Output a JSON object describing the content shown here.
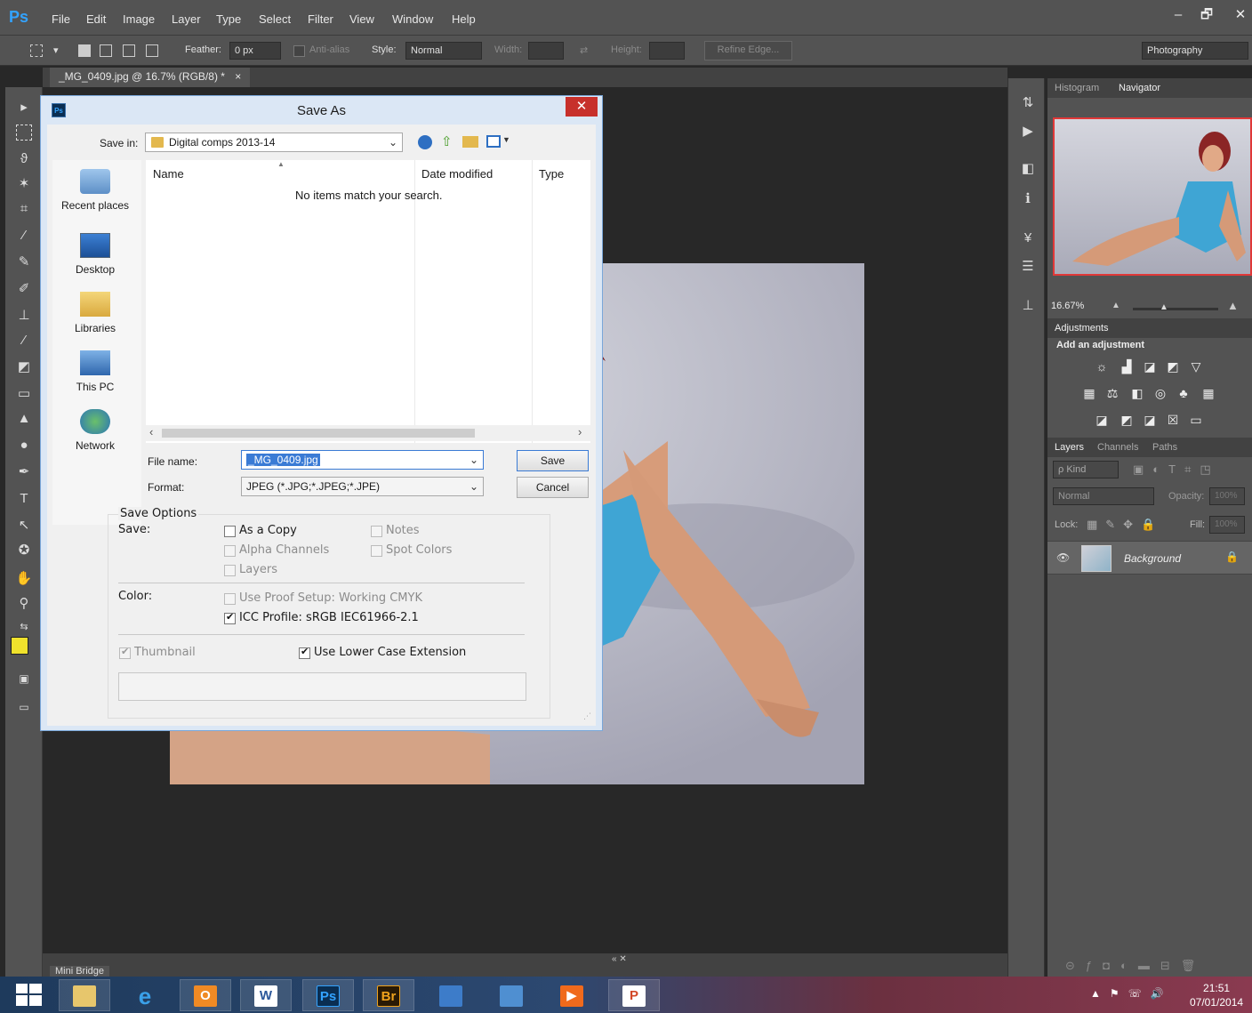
{
  "menubar": {
    "logo": "Ps",
    "items": [
      "File",
      "Edit",
      "Image",
      "Layer",
      "Type",
      "Select",
      "Filter",
      "View",
      "Window",
      "Help"
    ],
    "controls": {
      "minimize": "–",
      "restore": "🗗",
      "close": "✕"
    }
  },
  "options": {
    "feather_label": "Feather:",
    "feather_value": "0 px",
    "antialias_label": "Anti-alias",
    "style_label": "Style:",
    "style_value": "Normal",
    "width_label": "Width:",
    "height_label": "Height:",
    "refine_edge": "Refine Edge...",
    "workspace": "Photography"
  },
  "document": {
    "tab_title": "_MG_0409.jpg @ 16.7% (RGB/8) *",
    "tab_close": "×"
  },
  "panels": {
    "top_tabs": [
      "Histogram",
      "Navigator"
    ],
    "zoom": "16.67%",
    "adjustments_title": "Adjustments",
    "add_adjustment": "Add an adjustment",
    "layer_tabs": [
      "Layers",
      "Channels",
      "Paths"
    ],
    "kind_label": "ρ Kind",
    "blend_mode": "Normal",
    "opacity_label": "Opacity:",
    "opacity_value": "100%",
    "lock_label": "Lock:",
    "fill_label": "Fill:",
    "fill_value": "100%",
    "layer_name": "Background"
  },
  "minibridge": {
    "label": "Mini Bridge"
  },
  "dialog": {
    "title": "Save As",
    "close": "✕",
    "app_icon": "Ps",
    "save_in_label": "Save in:",
    "save_in_value": "Digital comps 2013-14",
    "columns": [
      "Name",
      "Date modified",
      "Type"
    ],
    "empty_message": "No items match your search.",
    "places": [
      "Recent places",
      "Desktop",
      "Libraries",
      "This PC",
      "Network"
    ],
    "file_name_label": "File name:",
    "file_name_value": "_MG_0409.jpg",
    "format_label": "Format:",
    "format_value": "JPEG (*.JPG;*.JPEG;*.JPE)",
    "save_button": "Save",
    "cancel_button": "Cancel",
    "save_options_title": "Save Options",
    "save_label": "Save:",
    "options": {
      "as_a_copy": "As a Copy",
      "notes": "Notes",
      "alpha_channels": "Alpha Channels",
      "spot_colors": "Spot Colors",
      "layers": "Layers"
    },
    "color_label": "Color:",
    "use_proof_setup": "Use Proof Setup:  Working CMYK",
    "icc_profile": "ICC Profile:  sRGB IEC61966-2.1",
    "thumbnail": "Thumbnail",
    "lower_case": "Use Lower Case Extension"
  },
  "taskbar": {
    "apps": [
      "W",
      "Ps",
      "Br",
      "P"
    ],
    "time": "21:51",
    "date": "07/01/2014"
  }
}
